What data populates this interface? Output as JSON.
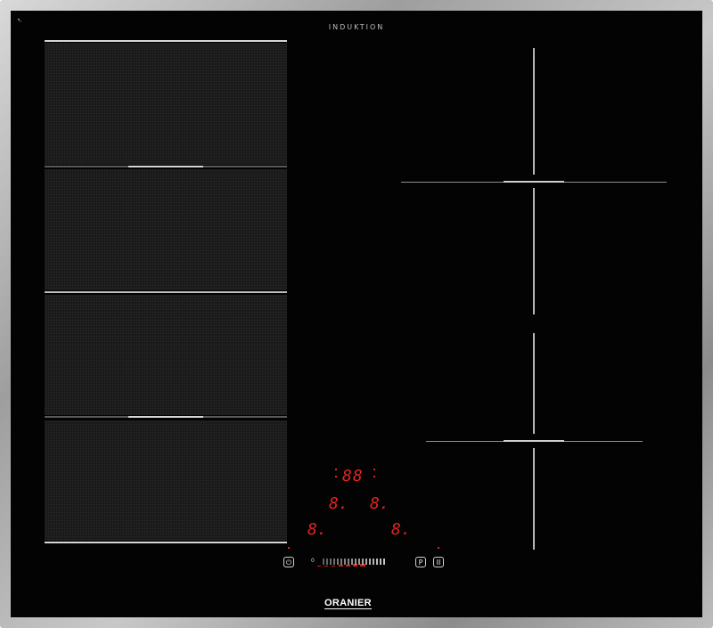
{
  "hob": {
    "top_label": "INDUKTION",
    "brand_logo": "ORANIER",
    "corner_icon": "small-arrow-icon"
  },
  "display": {
    "timer": "88",
    "left_power": "8.",
    "right_power": "8.",
    "bottom_left_power": "8.",
    "bottom_right_power": "8."
  },
  "controls": {
    "power_button": "power-icon",
    "power_button_glyph": "⏻",
    "boost_button_label": "P",
    "pause_button_glyph": "II",
    "slider_min_label": "0",
    "slider_level_fraction": 0.55
  },
  "colors": {
    "glass": "#030303",
    "display_red": "#e0251f",
    "frame": "#a9a9a9"
  }
}
